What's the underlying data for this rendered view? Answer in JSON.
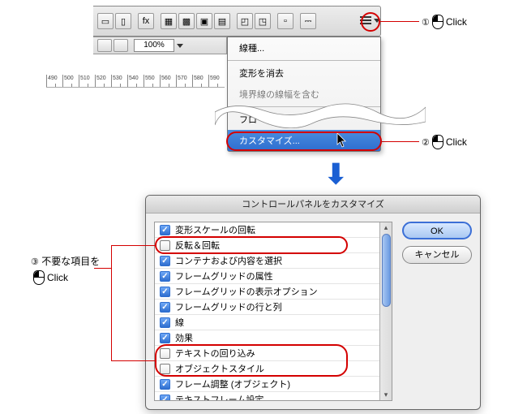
{
  "toolbar": {
    "zoom_value": "100%",
    "menu_trigger_name": "control-panel-menu"
  },
  "ruler": {
    "ticks": [
      "490",
      "500",
      "510",
      "520",
      "530",
      "540",
      "550",
      "560",
      "570",
      "580",
      "590"
    ]
  },
  "menu": {
    "items": [
      {
        "label": "線種...",
        "selected": false
      },
      {
        "label": "変形を消去",
        "selected": false
      },
      {
        "label": "境界線の線幅を含む",
        "selected": false,
        "cut": true
      },
      {
        "label": "フロート",
        "selected": false
      },
      {
        "label": "カスタマイズ...",
        "selected": true
      }
    ]
  },
  "arrow_glyph": "⬇",
  "dialog": {
    "title": "コントロールパネルをカスタマイズ",
    "ok_label": "OK",
    "cancel_label": "キャンセル",
    "options": [
      {
        "label": "変形スケールの回転",
        "checked": true
      },
      {
        "label": "反転＆回転",
        "checked": false
      },
      {
        "label": "コンテナおよび内容を選択",
        "checked": true
      },
      {
        "label": "フレームグリッドの属性",
        "checked": true
      },
      {
        "label": "フレームグリッドの表示オプション",
        "checked": true
      },
      {
        "label": "フレームグリッドの行と列",
        "checked": true
      },
      {
        "label": "線",
        "checked": true
      },
      {
        "label": "効果",
        "checked": true
      },
      {
        "label": "テキストの回り込み",
        "checked": false
      },
      {
        "label": "オブジェクトスタイル",
        "checked": false
      },
      {
        "label": "フレーム調整 (オブジェクト)",
        "checked": true
      },
      {
        "label": "テキストフレーム設定",
        "checked": true
      }
    ]
  },
  "annotations": {
    "one": {
      "num": "①",
      "text": "Click"
    },
    "two": {
      "num": "②",
      "text": "Click"
    },
    "three": {
      "num": "③",
      "label1": "不要な項目を",
      "label2": "Click"
    }
  }
}
